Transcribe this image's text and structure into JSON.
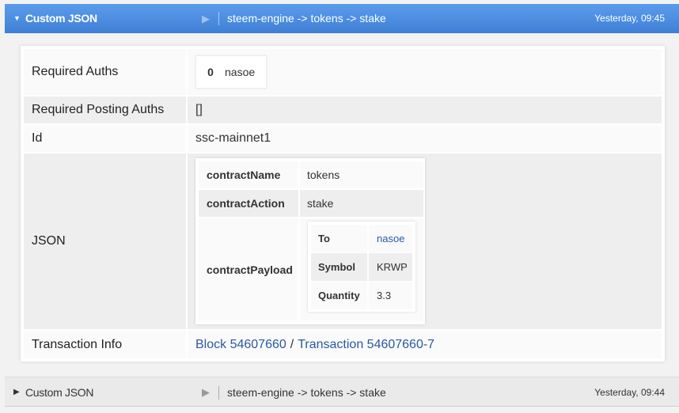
{
  "header_active": {
    "title": "Custom JSON",
    "operation": "steem-engine -> tokens -> stake",
    "time": "Yesterday, 09:45"
  },
  "details": {
    "required_auths": {
      "label": "Required Auths",
      "index": "0",
      "account": "nasoe"
    },
    "required_posting_auths": {
      "label": "Required Posting Auths",
      "value": "[]"
    },
    "id": {
      "label": "Id",
      "value": "ssc-mainnet1"
    },
    "json": {
      "label": "JSON",
      "contract_name": {
        "key": "contractName",
        "value": "tokens"
      },
      "contract_action": {
        "key": "contractAction",
        "value": "stake"
      },
      "contract_payload": {
        "key": "contractPayload",
        "to": {
          "key": "To",
          "value": "nasoe"
        },
        "symbol": {
          "key": "Symbol",
          "value": "KRWP"
        },
        "quantity": {
          "key": "Quantity",
          "value": "3.3"
        }
      }
    },
    "transaction_info": {
      "label": "Transaction Info",
      "block_link": "Block 54607660",
      "separator": "/",
      "transaction_link": "Transaction 54607660-7"
    }
  },
  "header_collapsed": {
    "title": "Custom JSON",
    "operation": "steem-engine -> tokens -> stake",
    "time": "Yesterday, 09:44"
  },
  "icons": {
    "expanded": "caret-down-icon",
    "collapsed": "caret-right-icon",
    "play": "play-icon"
  },
  "colors": {
    "header_active_bg": "#4a8be2",
    "link": "#2c58a3",
    "row_shade": "#eeeeee"
  }
}
